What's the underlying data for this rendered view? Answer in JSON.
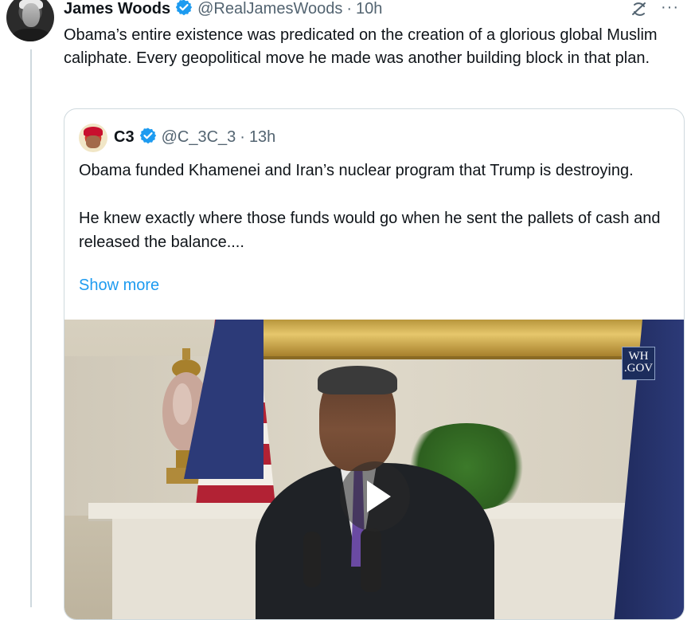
{
  "tweet": {
    "author_name": "James Woods",
    "handle": "@RealJamesWoods",
    "separator": "·",
    "time": "10h",
    "text": "Obama’s entire existence was predicated on the creation of a glorious global Muslim caliphate. Every geopolitical move he made was another building block in that plan.",
    "more_label": "···"
  },
  "quote": {
    "author_name": "C3",
    "handle": "@C_3C_3",
    "separator": "·",
    "time": "13h",
    "paragraph1": "Obama funded Khamenei and Iran’s nuclear program that Trump is destroying.",
    "paragraph2": "He knew exactly where those funds would go when he sent the pallets of cash and released the balance....",
    "show_more": "Show more",
    "media_badge_line1": "WH",
    "media_badge_line2": ".GOV"
  },
  "colors": {
    "verified": "#1d9bf0",
    "link": "#1d9bf0",
    "secondary_text": "#536471"
  }
}
